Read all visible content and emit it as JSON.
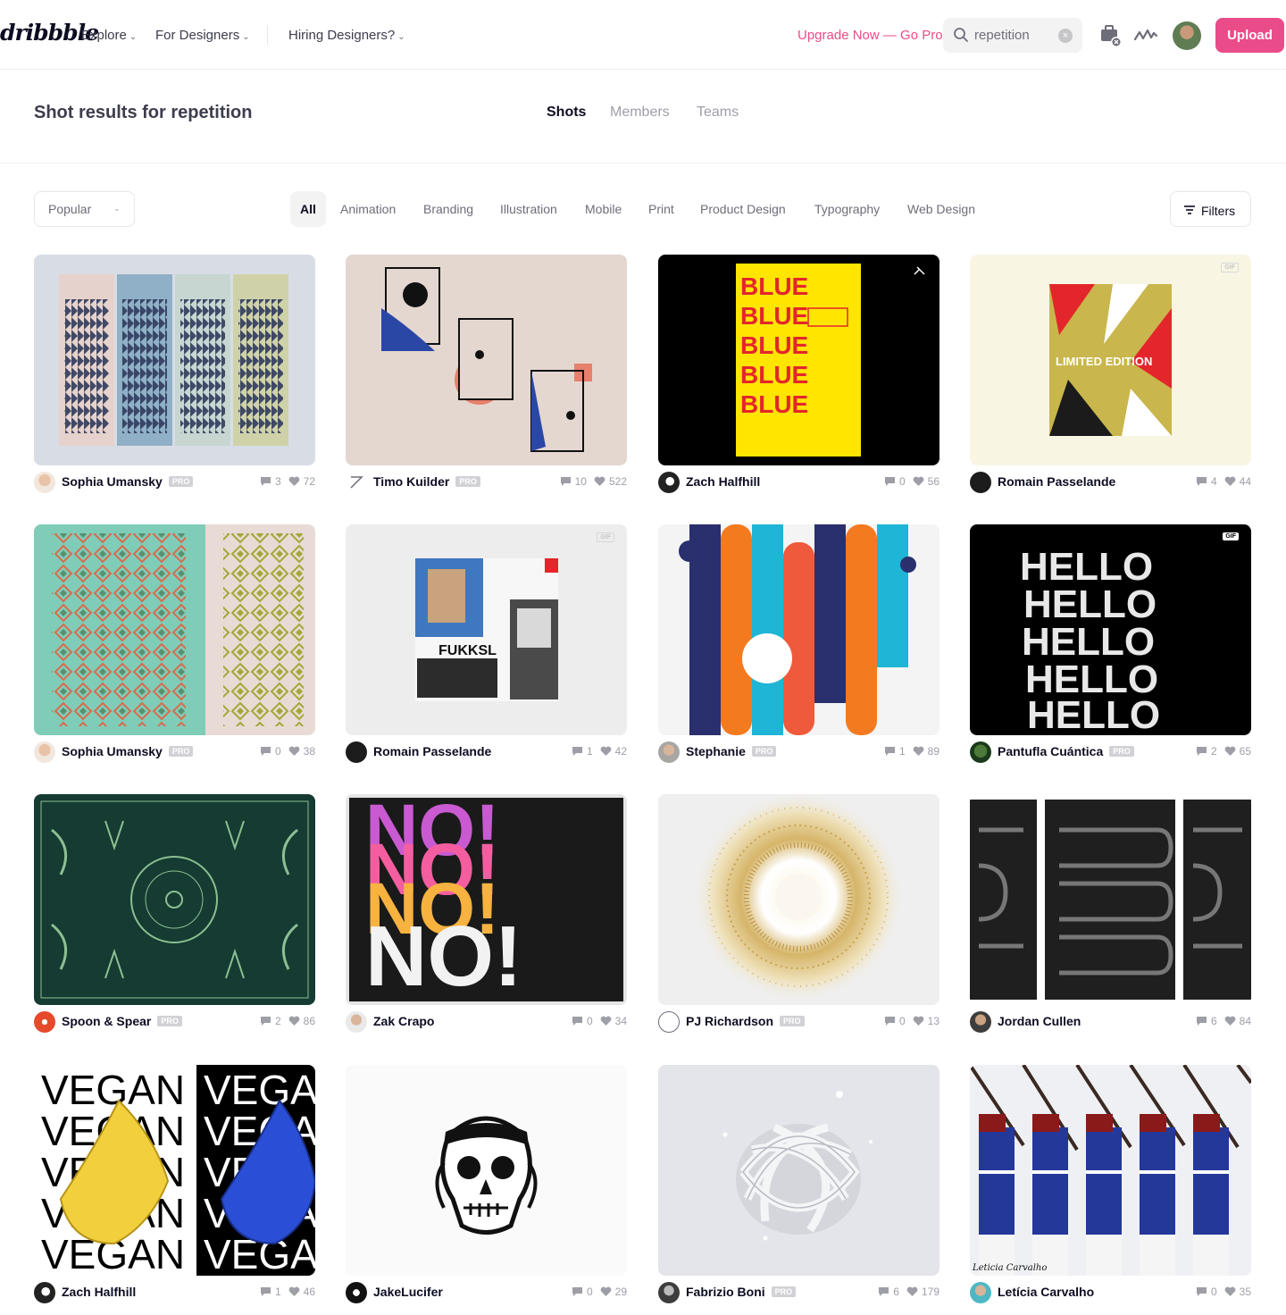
{
  "header": {
    "logo": "dribbble",
    "nav": [
      {
        "label": "Explore"
      },
      {
        "label": "For Designers"
      },
      {
        "label": "Hiring Designers?"
      }
    ],
    "upgrade": "Upgrade Now — Go Pro",
    "search_value": "repetition",
    "upload": "Upload"
  },
  "results": {
    "title": "Shot results for repetition",
    "tabs": [
      "Shots",
      "Members",
      "Teams"
    ]
  },
  "filters": {
    "sort": "Popular",
    "categories": [
      "All",
      "Animation",
      "Branding",
      "Illustration",
      "Mobile",
      "Print",
      "Product Design",
      "Typography",
      "Web Design"
    ],
    "button": "Filters"
  },
  "pro_label": "PRO",
  "gif_label": "GIF",
  "shots": [
    {
      "author": "Sophia Umansky",
      "pro": true,
      "comments": "3",
      "likes": "72"
    },
    {
      "author": "Timo Kuilder",
      "pro": true,
      "comments": "10",
      "likes": "522"
    },
    {
      "author": "Zach Halfhill",
      "pro": false,
      "comments": "0",
      "likes": "56"
    },
    {
      "author": "Romain Passelande",
      "pro": false,
      "comments": "4",
      "likes": "44"
    },
    {
      "author": "Sophia Umansky",
      "pro": true,
      "comments": "0",
      "likes": "38"
    },
    {
      "author": "Romain Passelande",
      "pro": false,
      "comments": "1",
      "likes": "42"
    },
    {
      "author": "Stephanie",
      "pro": true,
      "comments": "1",
      "likes": "89"
    },
    {
      "author": "Pantufla Cuántica",
      "pro": true,
      "comments": "2",
      "likes": "65"
    },
    {
      "author": "Spoon & Spear",
      "pro": true,
      "comments": "2",
      "likes": "86"
    },
    {
      "author": "Zak Crapo",
      "pro": false,
      "comments": "0",
      "likes": "34"
    },
    {
      "author": "PJ Richardson",
      "pro": true,
      "comments": "0",
      "likes": "13"
    },
    {
      "author": "Jordan Cullen",
      "pro": false,
      "comments": "6",
      "likes": "84"
    },
    {
      "author": "Zach Halfhill",
      "pro": false,
      "comments": "1",
      "likes": "46"
    },
    {
      "author": "JakeLucifer",
      "pro": false,
      "comments": "0",
      "likes": "29"
    },
    {
      "author": "Fabrizio Boni",
      "pro": true,
      "comments": "6",
      "likes": "179"
    },
    {
      "author": "Letícia Carvalho",
      "pro": false,
      "comments": "0",
      "likes": "35"
    }
  ],
  "artwork_text": {
    "blue_poster": "BLUE",
    "limited": "LIMITED EDITION",
    "fukk": "FUKKSL",
    "hello": "HELLO",
    "no": "NO!",
    "vegan": "VEGAN",
    "watermark": "Leticia Carvalho"
  }
}
